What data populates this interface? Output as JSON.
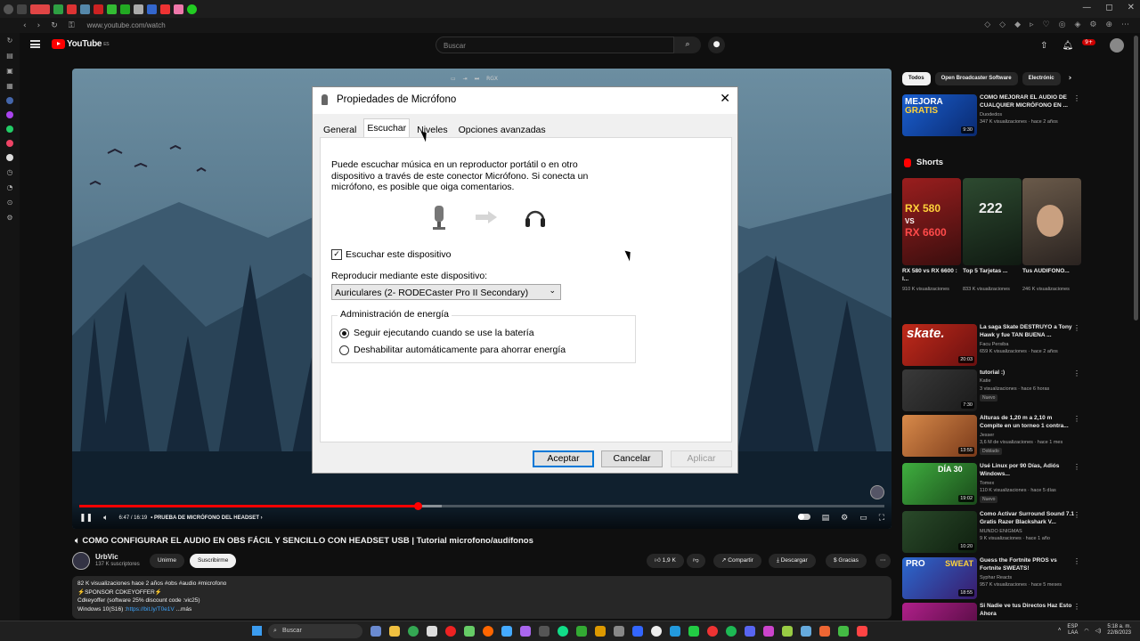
{
  "browser": {
    "url": "www.youtube.com/watch",
    "window_controls": [
      "—",
      "◻",
      "✕"
    ]
  },
  "youtube": {
    "logo": "YouTube",
    "logo_country": "ES",
    "search_placeholder": "Buscar",
    "notifications_count": "9+"
  },
  "player": {
    "time": "6:47 / 16:19",
    "chapter": "• PRUEBA DE MICRÓFONO DEL HEADSET ›",
    "progress": 0.42,
    "buffered": 0.45,
    "top_label": "RGX"
  },
  "dialog": {
    "title": "Propiedades de Micrófono",
    "close": "✕",
    "tabs": [
      "General",
      "Escuchar",
      "Niveles",
      "Opciones avanzadas"
    ],
    "active_tab": "Escuchar",
    "description": "Puede escuchar música en un reproductor portátil o en otro dispositivo a través de este conector Micrófono. Si conecta un micrófono, es posible que oiga comentarios.",
    "listen_checkbox_label": "Escuchar este dispositivo",
    "listen_checked": true,
    "playback_label": "Reproducir mediante este dispositivo:",
    "playback_device": "Auriculares (2- RODECaster Pro II Secondary)",
    "power_group_title": "Administración de energía",
    "power_options": [
      "Seguir ejecutando cuando se use la batería",
      "Deshabilitar automáticamente para ahorrar energía"
    ],
    "power_selected": 0,
    "buttons": {
      "ok": "Aceptar",
      "cancel": "Cancelar",
      "apply": "Aplicar"
    }
  },
  "video": {
    "title": "COMO CONFIGURAR EL AUDIO EN OBS FÁCIL Y SENCILLO CON HEADSET USB | Tutorial microfono/audífonos",
    "channel": "UrbVic",
    "subscribers": "137 K suscriptores",
    "join": "Unirme",
    "subscribe": "Suscribirme",
    "likes": "1,9 K",
    "share": "Compartir",
    "download": "Descargar",
    "thanks": "Gracias",
    "desc_line1": "82 K visualizaciones  hace 2 años  #obs #audio #microfono",
    "desc_line2": "⚡SPONSOR CDKEYOFFER⚡",
    "desc_line3": "Cdkeyoffer (software 25% discount code :vic25)",
    "desc_line4_pre": "Windows 10(S16) :",
    "desc_link": "https://bit.ly/T0e1V",
    "desc_more": "...más"
  },
  "sidebar": {
    "chips": [
      "Todos",
      "Open Broadcaster Software",
      "Electrónic"
    ],
    "shorts_title": "Shorts",
    "first_rec": {
      "title": "CÓMO MEJORAR EL AUDIO DE CUALQUIER MICRÓFONO EN ...",
      "channel": "Duodedos",
      "meta": "347 K visualizaciones · hace 2 años",
      "duration": "9:30"
    },
    "shorts": [
      {
        "title": "RX 580 vs RX 6600 : l...",
        "views": "910 K visualizaciones"
      },
      {
        "title": "Top 5 Tarjetas ...",
        "views": "833 K visualizaciones"
      },
      {
        "title": "Tus AUDIFONO...",
        "views": "246 K visualizaciones"
      }
    ],
    "recs": [
      {
        "title": "La saga Skate DESTRUYÓ a Tony Hawk y fue TAN BUENA ...",
        "channel": "Facu Persiba",
        "meta": "659 K visualizaciones · hace 2 años",
        "duration": "20:03"
      },
      {
        "title": "tutorial :)",
        "channel": "Katie",
        "meta": "3 visualizaciones · hace 6 horas",
        "duration": "7:30",
        "tag": "Nuevo"
      },
      {
        "title": "Alturas de 1,20 m a 2,10 m Compite en un torneo 1 contra...",
        "channel": "Jesser",
        "meta": "3,6 M de visualizaciones · hace 1 mes",
        "duration": "13:55",
        "tag": "Doblado"
      },
      {
        "title": "Usé Linux por 90 Días, Adiós Windows...",
        "channel": "Tomex",
        "meta": "110 K visualizaciones · hace 5 días",
        "duration": "19:02",
        "tag": "Nuevo"
      },
      {
        "title": "Como Activar Surround Sound 7.1 Gratis Razer Blackshark V...",
        "channel": "MUNDO ENIGMAS",
        "meta": "9 K visualizaciones · hace 1 año",
        "duration": "10:20"
      },
      {
        "title": "Guess the Fortnite PROS vs Fortnite SWEATS!",
        "channel": "Syphar Reacts",
        "meta": "957 K visualizaciones · hace 5 meses",
        "duration": "18:55"
      },
      {
        "title": "Si Nadie ve tus Directos Haz Esto Ahora",
        "channel": "",
        "meta": "",
        "duration": ""
      }
    ]
  },
  "taskbar": {
    "search": "Buscar",
    "lang": "ESP",
    "lang2": "LAA",
    "time": "5:18 a. m.",
    "date": "22/8/2023"
  }
}
